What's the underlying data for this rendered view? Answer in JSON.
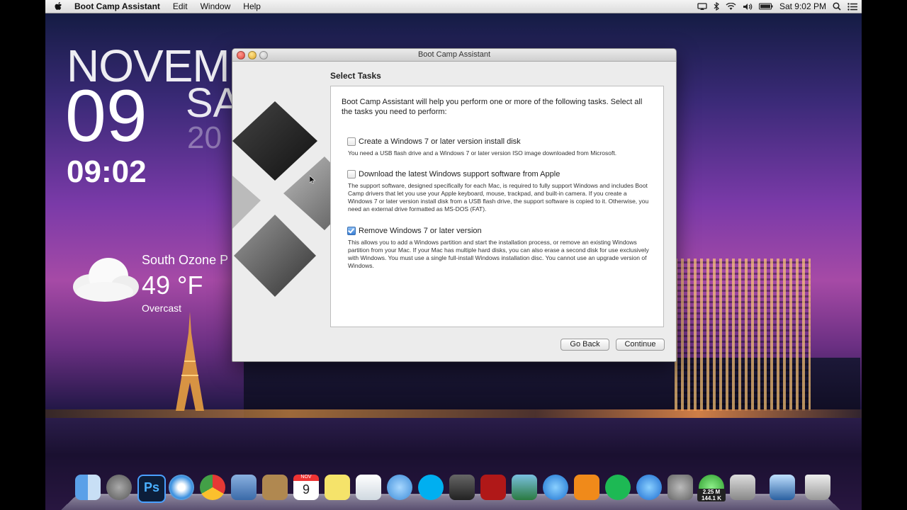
{
  "menubar": {
    "app_name": "Boot Camp Assistant",
    "items": [
      "Edit",
      "Window",
      "Help"
    ],
    "clock": "Sat 9:02 PM"
  },
  "desktop_widget": {
    "month": "NOVEMBER",
    "day": "09",
    "weekday": "SA",
    "year": "20",
    "time": "09:02",
    "location": "South Ozone P",
    "temperature": "49 °F",
    "condition": "Overcast"
  },
  "window": {
    "title": "Boot Camp Assistant",
    "section_title": "Select Tasks",
    "intro": "Boot Camp Assistant will help you perform one or more of the following tasks. Select all the tasks you need to perform:",
    "options": [
      {
        "label": "Create a Windows 7 or later version install disk",
        "description": "You need a USB flash drive and a Windows 7 or later version ISO image downloaded from Microsoft.",
        "checked": false
      },
      {
        "label": "Download the latest Windows support software from Apple",
        "description": "The support software, designed specifically for each Mac, is required to fully support Windows and includes Boot Camp drivers that let you use your Apple keyboard, mouse, trackpad, and built-in camera. If you create a Windows 7 or later version install disk from a USB flash drive, the support software is copied to it. Otherwise, you need an external drive formatted as MS-DOS (FAT).",
        "checked": false
      },
      {
        "label": "Remove Windows 7 or later version",
        "description": "This allows you to add a Windows partition and start the installation process, or remove an existing Windows partition from your Mac. If your Mac has multiple hard disks, you can also erase a second disk for use exclusively with Windows. You must use a single full-install Windows installation disc. You cannot use an upgrade version of Windows.",
        "checked": true
      }
    ],
    "go_back_label": "Go Back",
    "continue_label": "Continue"
  },
  "dock": {
    "calendar_day": "9",
    "calendar_month": "NOV",
    "net_up": "2.25 M",
    "net_down": "144.1 K",
    "icons": [
      "finder-icon",
      "launchpad-icon",
      "photoshop-icon",
      "safari-icon",
      "chrome-icon",
      "mail-icon",
      "contacts-icon",
      "calendar-icon",
      "notes-icon",
      "preview-icon",
      "messages-icon",
      "skype-icon",
      "facetime-icon",
      "photo-booth-icon",
      "iphoto-icon",
      "itunes-icon",
      "ibooks-icon",
      "spotify-icon",
      "app-store-icon",
      "system-preferences-icon",
      "network-monitor-icon",
      "bootcamp-icon",
      "downloads-stack-icon",
      "trash-icon"
    ],
    "ps_label": "Ps"
  },
  "colors": {
    "accent": "#3a7fd6",
    "window_bg": "#ececec"
  }
}
